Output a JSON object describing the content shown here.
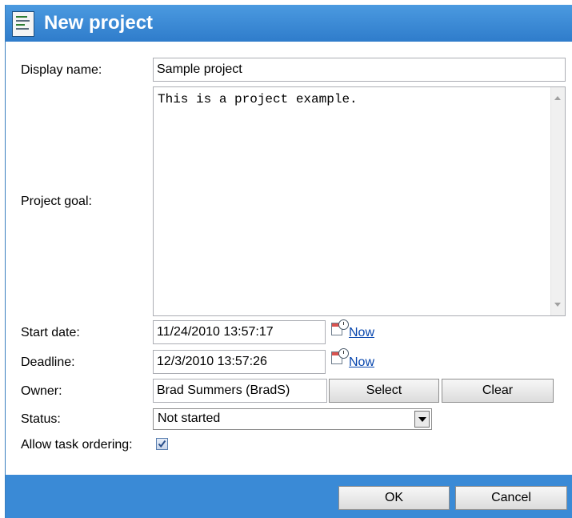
{
  "dialog": {
    "title": "New project",
    "title_icon": "project-icon"
  },
  "form": {
    "display_name": {
      "label": "Display name:",
      "value": "Sample project"
    },
    "project_goal": {
      "label": "Project goal:",
      "value": "This is a project example."
    },
    "start_date": {
      "label": "Start date:",
      "value": "11/24/2010 13:57:17",
      "now_link": "Now",
      "icon": "calendar-clock-icon"
    },
    "deadline": {
      "label": "Deadline:",
      "value": "12/3/2010 13:57:26",
      "now_link": "Now",
      "icon": "calendar-clock-icon"
    },
    "owner": {
      "label": "Owner:",
      "value": "Brad Summers (BradS)",
      "select_button": "Select",
      "clear_button": "Clear"
    },
    "status": {
      "label": "Status:",
      "selected": "Not started"
    },
    "allow_task_ordering": {
      "label": "Allow task ordering:",
      "checked": true
    }
  },
  "footer": {
    "ok_button": "OK",
    "cancel_button": "Cancel"
  },
  "colors": {
    "title_bar": "#3a8ad6",
    "footer_bar": "#3a8ad6",
    "link": "#0645ad"
  }
}
